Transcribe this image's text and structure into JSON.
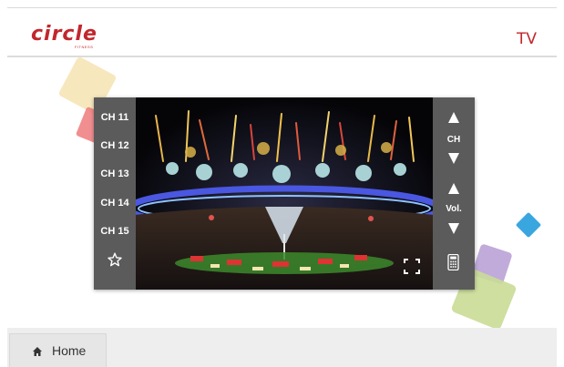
{
  "header": {
    "logo_text": "circle",
    "logo_sub": "FITNESS",
    "title": "TV"
  },
  "channels": [
    "CH 11",
    "CH 12",
    "CH 13",
    "CH 14",
    "CH 15"
  ],
  "controls": {
    "channel_label": "CH",
    "volume_label": "Vol."
  },
  "footer": {
    "home_label": "Home"
  },
  "colors": {
    "brand_red": "#c1272d",
    "panel_gray": "#5b5b5b",
    "footer_bg": "#eeeeee"
  }
}
